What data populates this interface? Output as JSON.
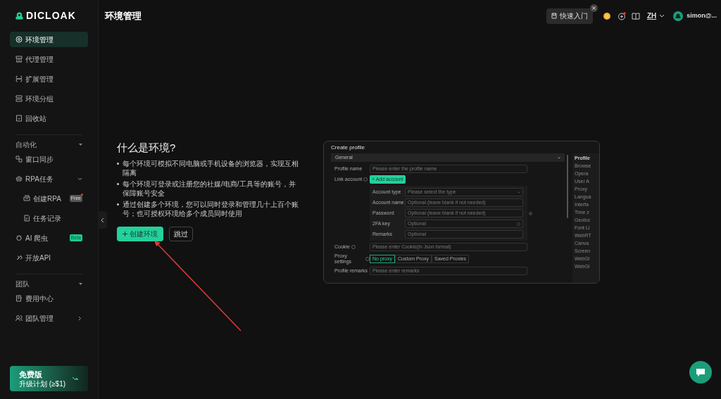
{
  "logo": {
    "text": "DICLOAK"
  },
  "sidebar": {
    "items": [
      {
        "kind": "item",
        "label": "环境管理",
        "selected": true
      },
      {
        "kind": "item",
        "label": "代理管理",
        "selected": false
      },
      {
        "kind": "item",
        "label": "扩展管理",
        "selected": false
      },
      {
        "kind": "item",
        "label": "环境分组",
        "selected": false
      },
      {
        "kind": "item",
        "label": "回收站",
        "selected": false
      },
      {
        "kind": "section",
        "label": "自动化",
        "expanded": true
      },
      {
        "kind": "item",
        "label": "窗口同步",
        "selected": false
      },
      {
        "kind": "item",
        "label": "RPA任务",
        "selected": false,
        "expanded": true
      },
      {
        "kind": "subitem",
        "label": "创建RPA",
        "selected": false,
        "badge": {
          "text": "Free",
          "kind": "free",
          "dot": true
        }
      },
      {
        "kind": "subitem",
        "label": "任务记录",
        "selected": false
      },
      {
        "kind": "item",
        "label": "AI 爬虫",
        "selected": false,
        "badge": {
          "text": "Beta",
          "kind": "beta",
          "dot": false
        }
      },
      {
        "kind": "item",
        "label": "开放API",
        "selected": false
      },
      {
        "kind": "section",
        "label": "团队",
        "expanded": true
      },
      {
        "kind": "item",
        "label": "费用中心",
        "selected": false
      },
      {
        "kind": "item",
        "label": "团队管理",
        "selected": false,
        "expanded": false
      }
    ]
  },
  "plan": {
    "title": "免费版",
    "subtitle": "升级计划 (≥$1)"
  },
  "header": {
    "title": "环境管理",
    "quick_start": "快速入门",
    "language": "ZH",
    "user": "simon@..."
  },
  "intro": {
    "heading": "什么是环境?",
    "bullets": [
      "每个环境可模拟不同电脑或手机设备的浏览器，实现互相隔离",
      "每个环境可登录或注册您的社媒/电商/工具等的账号，并保障账号安全",
      "通过创建多个环境，您可以同时登录和管理几十上百个账号；也可授权环境给多个成员同时使用"
    ],
    "primary_button": "创建环境",
    "secondary_button": "跳过"
  },
  "preview": {
    "title": "Create profile",
    "section": "General",
    "rows": [
      {
        "kind": "input",
        "label": "Profile name",
        "placeholder": "Please enter the profile name",
        "info": false
      },
      {
        "kind": "button",
        "label": "Link account",
        "button": "+ Add account",
        "info": true
      },
      {
        "kind": "subform",
        "fields": [
          {
            "label": "Account type",
            "placeholder": "Please select the type",
            "kind": "select"
          },
          {
            "label": "Account name",
            "placeholder": "Optional (leave blank if not needed)",
            "kind": "input"
          },
          {
            "label": "Password",
            "placeholder": "Optional (leave blank if not needed)",
            "kind": "input"
          },
          {
            "label": "2FA key",
            "placeholder": "Optional",
            "kind": "help"
          },
          {
            "label": "Remarks",
            "placeholder": "Optional",
            "kind": "input"
          }
        ]
      },
      {
        "kind": "input",
        "label": "Cookie",
        "placeholder": "Please enter Cookie(in Json format)",
        "info": true
      },
      {
        "kind": "segmented",
        "label": "Proxy settings",
        "info": true,
        "options": [
          {
            "label": "No proxy",
            "selected": true
          },
          {
            "label": "Custom Proxy",
            "selected": false
          },
          {
            "label": "Saved Proxies",
            "selected": false
          }
        ]
      },
      {
        "kind": "input",
        "label": "Profile remarks",
        "placeholder": "Please enter remarks",
        "info": false
      }
    ],
    "side_title": "Profile",
    "side_labels": [
      "Browse",
      "Opera",
      "User A",
      "Proxy",
      "Langua",
      "Interfa",
      "Time z",
      "Geoloc",
      "Font Li",
      "WebRT",
      "Canva",
      "Screen",
      "WebGl",
      "WebGl"
    ]
  }
}
